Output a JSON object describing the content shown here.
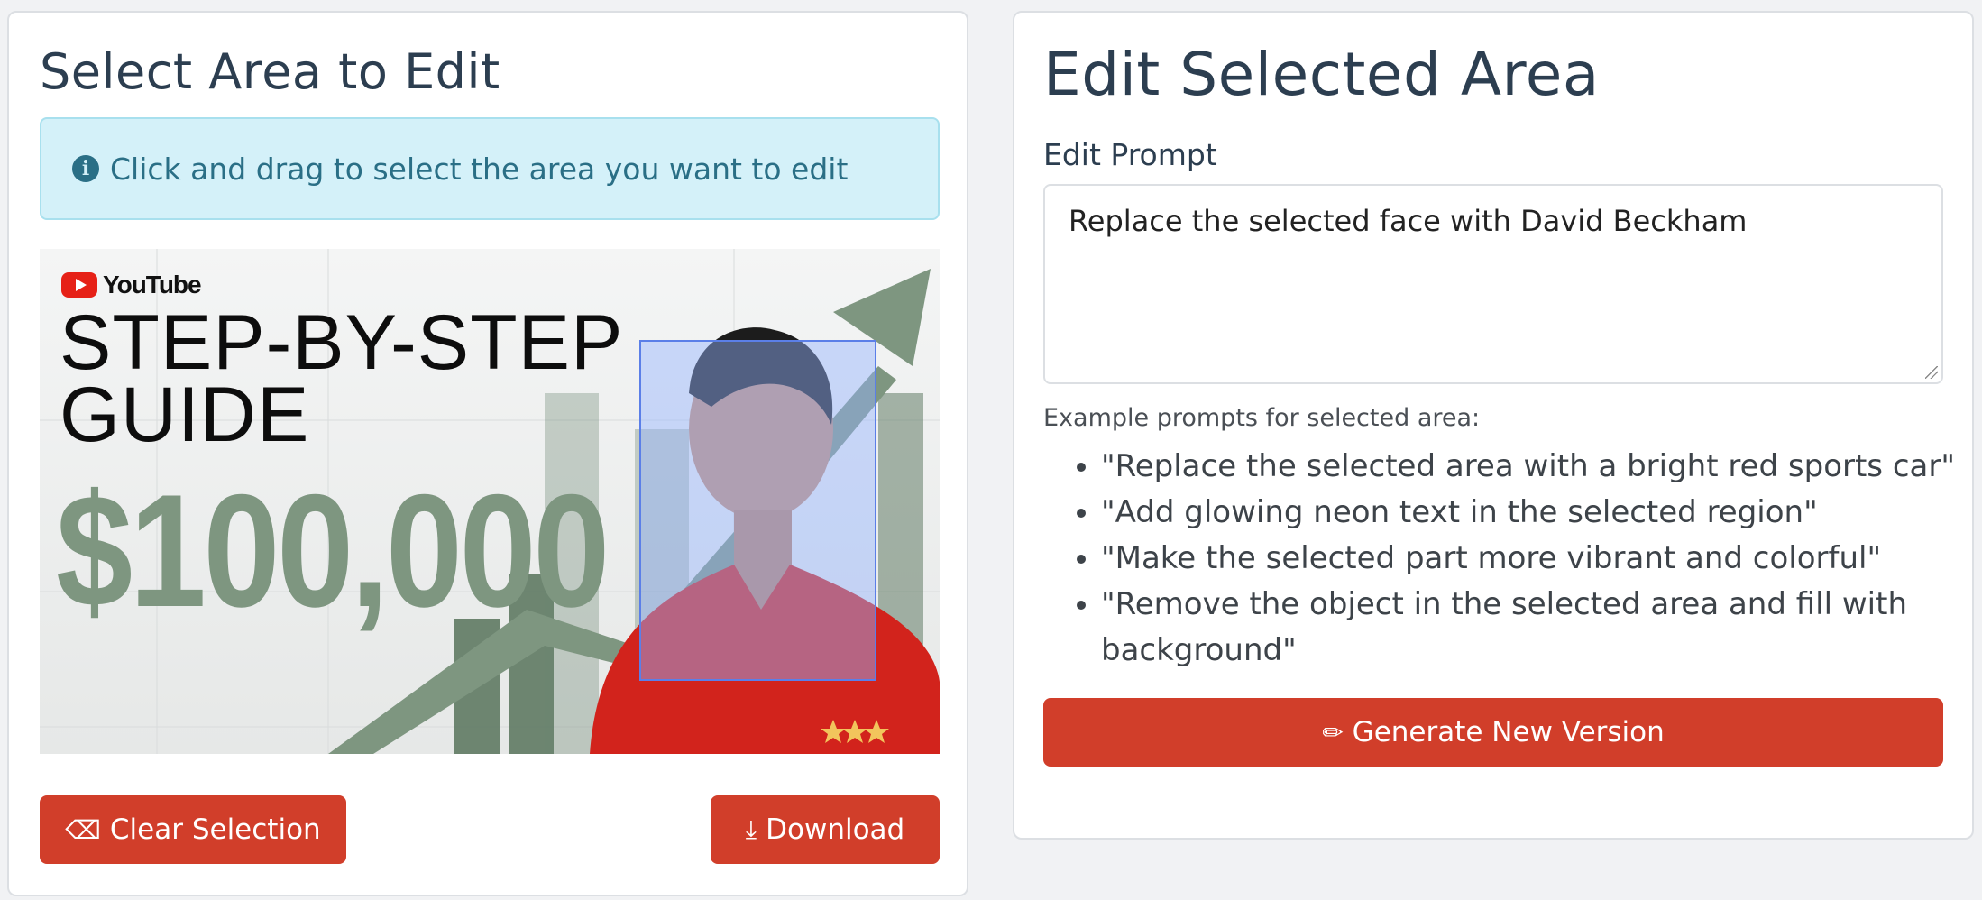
{
  "left_panel": {
    "title": "Select Area to Edit",
    "info_text": "Click and drag to select the area you want to edit",
    "thumbnail": {
      "brand": "YouTube",
      "headline_line1": "STEP-BY-STEP",
      "headline_line2": "GUIDE",
      "amount": "$100,000"
    },
    "clear_button": "Clear Selection",
    "download_button": "Download"
  },
  "right_panel": {
    "title": "Edit Selected Area",
    "prompt_label": "Edit Prompt",
    "prompt_value": "Replace the selected face with David Beckham",
    "examples_label": "Example prompts for selected area:",
    "examples": [
      "\"Replace the selected area with a bright red sports car\"",
      "\"Add glowing neon text in the selected region\"",
      "\"Make the selected part more vibrant and colorful\"",
      "\"Remove the object in the selected area and fill with background\""
    ],
    "generate_button": "Generate New Version"
  },
  "colors": {
    "accent": "#d13e2a",
    "info_bg": "#d4f1f9",
    "selection": "#5b7fe8"
  },
  "icons": [
    "info-icon",
    "eraser-icon",
    "download-icon",
    "pencil-icon",
    "youtube-icon"
  ]
}
